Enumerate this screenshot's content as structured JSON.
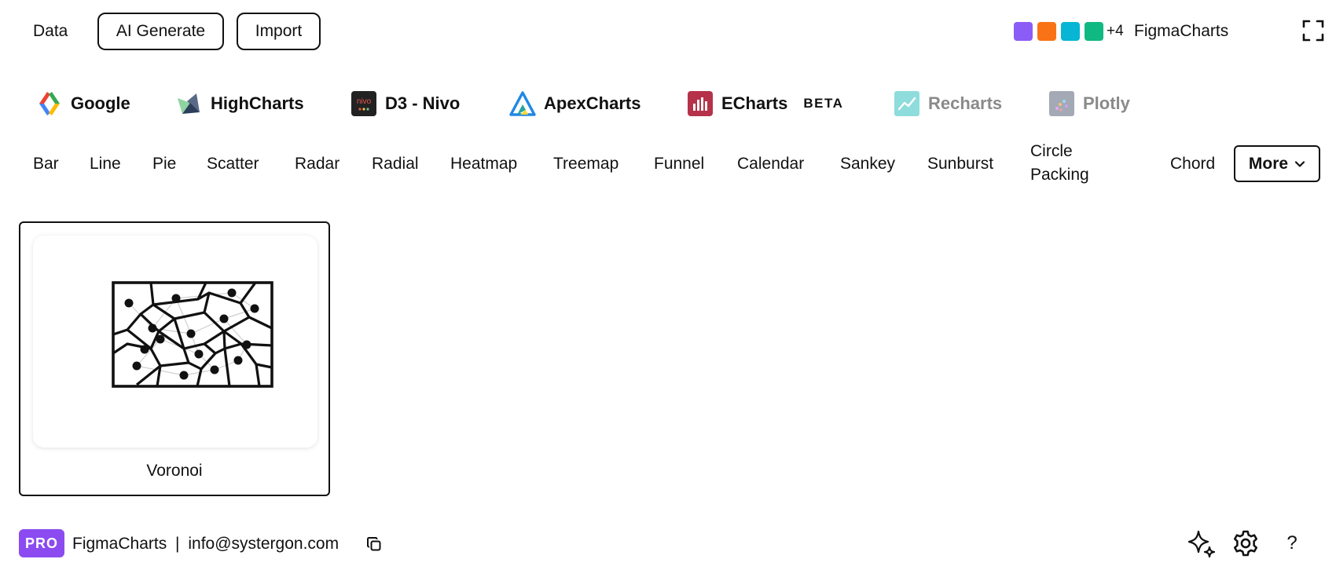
{
  "topbar": {
    "data_label": "Data",
    "ai_generate_label": "AI Generate",
    "import_label": "Import",
    "palette_colors": [
      "#8b5cf6",
      "#f97316",
      "#06b6d4",
      "#10b981"
    ],
    "palette_more": "+4",
    "brand": "FigmaCharts",
    "expand_icon": "fullscreen-icon"
  },
  "libraries": [
    {
      "label": "Google",
      "icon": "google-charts-logo",
      "enabled": true
    },
    {
      "label": "HighCharts",
      "icon": "highcharts-logo",
      "enabled": true
    },
    {
      "label": "D3 - Nivo",
      "icon": "nivo-logo",
      "icon_text": "nivo",
      "enabled": true
    },
    {
      "label": "ApexCharts",
      "icon": "apexcharts-logo",
      "enabled": true
    },
    {
      "label": "ECharts",
      "icon": "echarts-logo",
      "badge": "BETA",
      "enabled": true
    },
    {
      "label": "Recharts",
      "icon": "recharts-logo",
      "enabled": false
    },
    {
      "label": "Plotly",
      "icon": "plotly-logo",
      "enabled": false
    }
  ],
  "chart_types": {
    "tabs": [
      "Bar",
      "Line",
      "Pie",
      "Scatter",
      "Radar",
      "Radial",
      "Heatmap",
      "Treemap",
      "Funnel",
      "Calendar",
      "Sankey",
      "Sunburst",
      "Circle Packing",
      "Chord"
    ],
    "more_label": "More"
  },
  "gallery": {
    "cards": [
      {
        "label": "Voronoi",
        "thumbnail_icon": "voronoi-diagram-icon"
      }
    ]
  },
  "footer": {
    "badge": "PRO",
    "brand": "FigmaCharts",
    "separator": "|",
    "email": "info@systergon.com",
    "copy_icon": "copy-icon",
    "ai_icon": "sparkles-icon",
    "settings_icon": "gear-icon",
    "help_label": "?"
  }
}
